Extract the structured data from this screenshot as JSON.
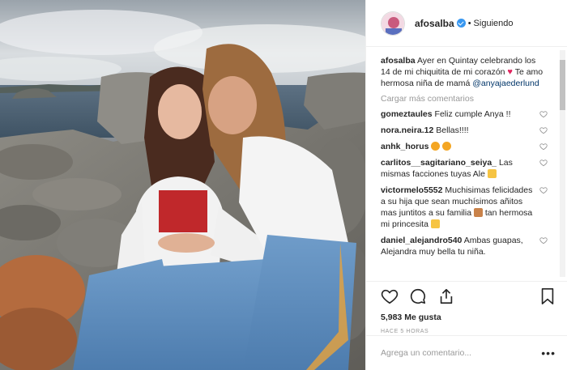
{
  "post": {
    "username": "afosalba",
    "separator": "•",
    "follow_status": "Siguiendo",
    "caption_user": "afosalba",
    "caption_text": "Ayer en Quintay celebrando los 14 de mi chiquitita de mi corazón",
    "caption_tail": "Te amo hermosa niña de mamá",
    "caption_mention": "@anyajaederlund",
    "load_more": "Cargar más comentarios",
    "comments": [
      {
        "user": "gomeztaules",
        "text": "Feliz cumple Anya !!"
      },
      {
        "user": "nora.neira.12",
        "text": "Bellas!!!!"
      },
      {
        "user": "anhk_horus",
        "text": ""
      },
      {
        "user": "carlitos__sagitariano_seiya_",
        "text": "Las mismas facciones tuyas Ale"
      },
      {
        "user": "victormelo5552",
        "text": "Muchisimas felicidades a su hija que sean muchísimos añitos mas juntitos a su familia",
        "text2": "tan hermosa mi princesita"
      },
      {
        "user": "daniel_alejandro540",
        "text": "Ambas guapas, Alejandra muy bella tu niña."
      }
    ],
    "likes": "5,983 Me gusta",
    "time": "HACE 5 HORAS",
    "comment_placeholder": "Agrega un comentario...",
    "more_icon": "•••",
    "icons": [
      "heart-icon",
      "comment-icon",
      "share-icon",
      "bookmark-icon"
    ],
    "colors": {
      "verified": "#3897f0",
      "mention": "#003569",
      "heart_emoji": "#e0245e"
    }
  }
}
